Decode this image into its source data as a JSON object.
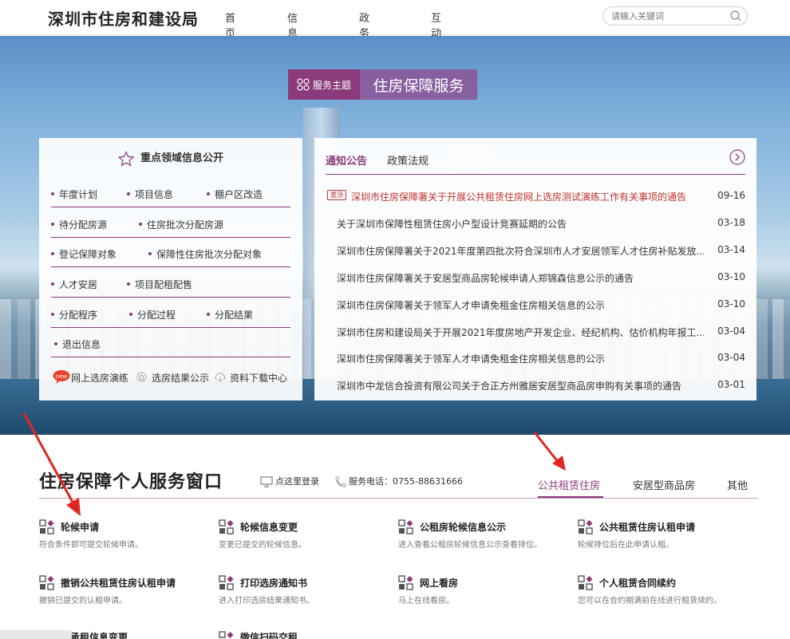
{
  "header": {
    "logo": "深圳市住房和建设局",
    "nav": [
      "首页",
      "信息公开",
      "政务服务",
      "互动交流"
    ],
    "search_placeholder": "请输入关键词"
  },
  "theme": {
    "tag": "服务主题",
    "title": "住房保障服务"
  },
  "left_panel": {
    "title": "重点领域信息公开",
    "rows": [
      [
        "年度计划",
        "项目信息",
        "棚户区改造"
      ],
      [
        "待分配房源",
        "住房批次分配房源"
      ],
      [
        "登记保障对象",
        "保障性住房批次分配对象"
      ],
      [
        "人才安居",
        "项目配租配售"
      ],
      [
        "分配程序",
        "分配过程",
        "分配结果"
      ],
      [
        "退出信息"
      ]
    ],
    "footer": [
      "网上选房演练",
      "选房结果公示",
      "资料下载中心"
    ],
    "new_badge": "new"
  },
  "right_panel": {
    "tabs": [
      "通知公告",
      "政策法规"
    ],
    "top_badge": "置顶",
    "news": [
      {
        "title": "深圳市住房保障署关于开展公共租赁住房网上选房测试演练工作有关事项的通告",
        "date": "09-16",
        "top": true
      },
      {
        "title": "关于深圳市保障性租赁住房小户型设计竞赛延期的公告",
        "date": "03-18"
      },
      {
        "title": "深圳市住房保障署关于2021年度第四批次符合深圳市人才安居领军人才住房补贴发放...",
        "date": "03-14"
      },
      {
        "title": "深圳市住房保障署关于安居型商品房轮候申请人郑锦森信息公示的通告",
        "date": "03-10"
      },
      {
        "title": "深圳市住房保障署关于领军人才申请免租金住房相关信息的公示",
        "date": "03-10"
      },
      {
        "title": "深圳市住房和建设局关于开展2021年度房地产开发企业、经纪机构、估价机构年报工...",
        "date": "03-04"
      },
      {
        "title": "深圳市住房保障署关于领军人才申请免租金住房相关信息的公示",
        "date": "03-04"
      },
      {
        "title": "深圳市中龙信合投资有限公司关于合正方州雅居安居型商品房申购有关事项的通告",
        "date": "03-01"
      }
    ]
  },
  "service": {
    "title": "住房保障个人服务窗口",
    "login": "点这里登录",
    "phone": "服务电话：0755-88631666",
    "tabs": [
      "公共租赁住房",
      "安居型商品房",
      "其他"
    ],
    "items": [
      {
        "name": "轮候申请",
        "desc": "符合条件即可提交轮候申请。"
      },
      {
        "name": "轮候信息变更",
        "desc": "变更已提交的轮候信息。"
      },
      {
        "name": "公租房轮候信息公示",
        "desc": "进入查看公租房轮候信息公示查看排位。"
      },
      {
        "name": "公共租赁住房认租申请",
        "desc": "轮候排位后在此申请认租。"
      },
      {
        "name": "撤销公共租赁住房认租申请",
        "desc": "撤销已提交的认租申请。"
      },
      {
        "name": "打印选房通知书",
        "desc": "进入打印选房结果通知书。"
      },
      {
        "name": "网上看房",
        "desc": "马上在线看房。"
      },
      {
        "name": "个人租赁合同续约",
        "desc": "您可以在合约期满前在线进行租赁续约。"
      },
      {
        "name": "人承租信息变更",
        "desc": ""
      },
      {
        "name": "微信扫码交租",
        "desc": ""
      }
    ]
  },
  "colors": {
    "accent": "#8b3b7b",
    "alert": "#c0342a",
    "arrow": "#e0271f"
  }
}
